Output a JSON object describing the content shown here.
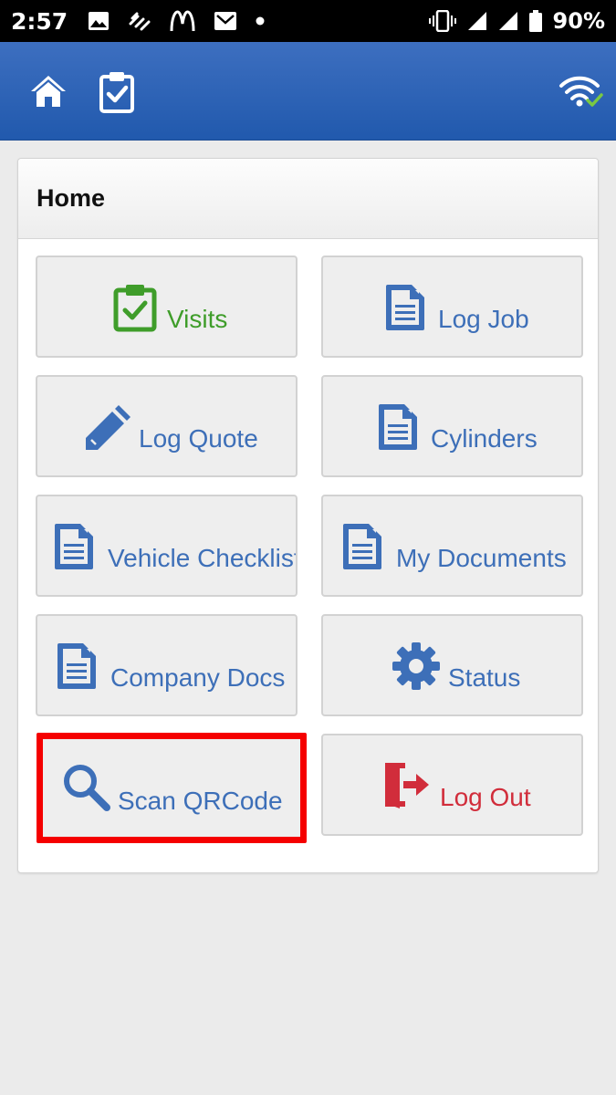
{
  "status_bar": {
    "time": "2:57",
    "battery_text": "90%"
  },
  "app_bar": {
    "icons": [
      "home-icon",
      "clipboard-check-icon",
      "wifi-connected-icon"
    ]
  },
  "panel": {
    "title": "Home"
  },
  "tiles": [
    {
      "label": "Visits",
      "icon": "clipboard-check-icon",
      "color": "#3f9d2a"
    },
    {
      "label": "Log Job",
      "icon": "document-icon",
      "color": "#3d6fb8"
    },
    {
      "label": "Log Quote",
      "icon": "pencil-icon",
      "color": "#3d6fb8"
    },
    {
      "label": "Cylinders",
      "icon": "document-icon",
      "color": "#3d6fb8"
    },
    {
      "label": "Vehicle Checklist",
      "icon": "document-icon",
      "color": "#3d6fb8"
    },
    {
      "label": "My Documents",
      "icon": "document-icon",
      "color": "#3d6fb8"
    },
    {
      "label": "Company Docs",
      "icon": "document-icon",
      "color": "#3d6fb8"
    },
    {
      "label": "Status",
      "icon": "gear-icon",
      "color": "#3d6fb8"
    },
    {
      "label": "Scan QRCode",
      "icon": "search-icon",
      "color": "#3d6fb8",
      "highlighted": true
    },
    {
      "label": "Log Out",
      "icon": "logout-door-icon",
      "color": "#d12d3b"
    }
  ],
  "colors": {
    "app_bar": "#2a62b6",
    "highlight": "#f50000",
    "tile_text": "#3d6fb8"
  }
}
